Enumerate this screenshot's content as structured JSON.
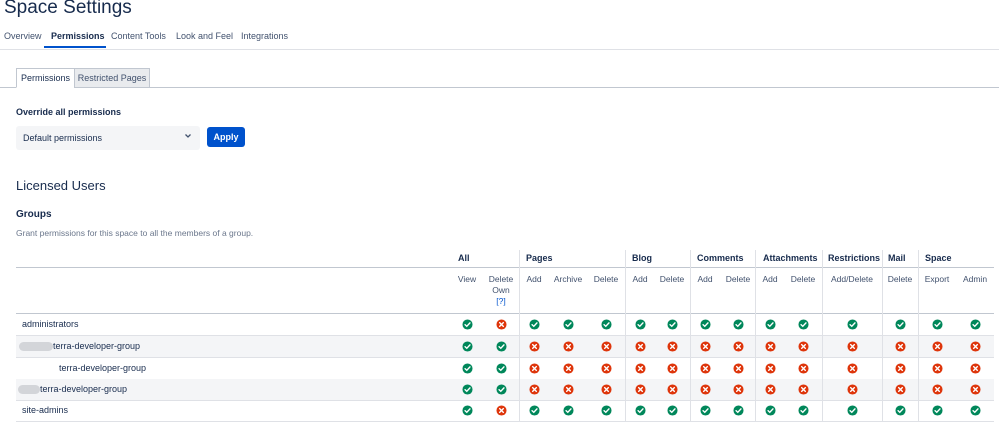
{
  "page": {
    "title": "Space Settings"
  },
  "top_tabs": [
    {
      "label": "Overview"
    },
    {
      "label": "Permissions"
    },
    {
      "label": "Content Tools"
    },
    {
      "label": "Look and Feel"
    },
    {
      "label": "Integrations"
    }
  ],
  "sub_tabs": [
    {
      "label": "Permissions"
    },
    {
      "label": "Restricted Pages"
    }
  ],
  "override": {
    "label": "Override all permissions",
    "select_value": "Default permissions",
    "apply_label": "Apply"
  },
  "licensed_users": {
    "title": "Licensed Users"
  },
  "groups": {
    "title": "Groups",
    "description": "Grant permissions for this space to all the members of a group."
  },
  "categories": [
    "All",
    "Pages",
    "Blog",
    "Comments",
    "Attachments",
    "Restrictions",
    "Mail",
    "Space"
  ],
  "permissions": [
    {
      "label": "View"
    },
    {
      "label": "Delete Own",
      "link": "[?]"
    },
    {
      "label": "Add"
    },
    {
      "label": "Archive"
    },
    {
      "label": "Delete"
    },
    {
      "label": "Add"
    },
    {
      "label": "Delete"
    },
    {
      "label": "Add"
    },
    {
      "label": "Delete"
    },
    {
      "label": "Add"
    },
    {
      "label": "Delete"
    },
    {
      "label": "Add/Delete"
    },
    {
      "label": "Delete"
    },
    {
      "label": "Export"
    },
    {
      "label": "Admin"
    }
  ],
  "rows": [
    {
      "name": "administrators",
      "perms": [
        true,
        false,
        true,
        true,
        true,
        true,
        true,
        true,
        true,
        true,
        true,
        true,
        true,
        true,
        true
      ]
    },
    {
      "name": "terra-developer-group",
      "perms": [
        true,
        true,
        false,
        false,
        false,
        false,
        false,
        false,
        false,
        false,
        false,
        false,
        false,
        false,
        false
      ]
    },
    {
      "name": "terra-developer-group",
      "perms": [
        true,
        true,
        false,
        false,
        false,
        false,
        false,
        false,
        false,
        false,
        false,
        false,
        false,
        false,
        false
      ]
    },
    {
      "name": "terra-developer-group",
      "perms": [
        true,
        true,
        false,
        false,
        false,
        false,
        false,
        false,
        false,
        false,
        false,
        false,
        false,
        false,
        false
      ]
    },
    {
      "name": "site-admins",
      "perms": [
        true,
        false,
        true,
        true,
        true,
        true,
        true,
        true,
        true,
        true,
        true,
        true,
        true,
        true,
        true
      ]
    }
  ],
  "colors": {
    "granted": "#00875a",
    "denied": "#de350b",
    "accent": "#0052cc"
  },
  "icons": {
    "granted": "check-circle-icon",
    "denied": "cross-circle-icon",
    "select": "chevron-down-icon"
  }
}
